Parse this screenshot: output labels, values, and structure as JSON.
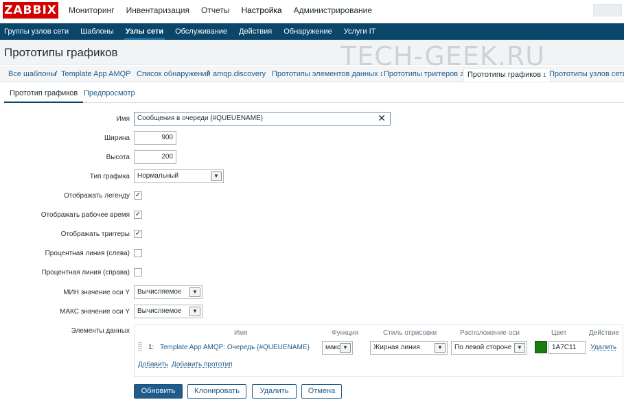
{
  "logo": "ZABBIX",
  "main_menu": [
    "Мониторинг",
    "Инвентаризация",
    "Отчеты",
    "Настройка",
    "Администрирование"
  ],
  "sub_menu": [
    "Группы узлов сети",
    "Шаблоны",
    "Узлы сети",
    "Обслуживание",
    "Действия",
    "Обнаружение",
    "Услуги IT"
  ],
  "page_title": "Прототипы графиков",
  "watermark": "TECH-GEEK.RU",
  "breadcrumbs": {
    "all_templates": "Все шаблоны",
    "template": "Template App AMQP",
    "discovery_list": "Список обнаружений",
    "discovery": "amqp.discovery",
    "item_prototypes": "Прототипы элементов данных",
    "item_prototypes_count": "1",
    "trigger_prototypes": "Прототипы триггеров",
    "trigger_prototypes_count": "2",
    "graph_prototypes": "Прототипы графиков",
    "graph_prototypes_count": "1",
    "host_prototypes": "Прототипы узлов сети"
  },
  "tabs": [
    "Прототип графиков",
    "Предпросмотр"
  ],
  "form": {
    "name_label": "Имя",
    "name_value": "Сообщения в очереди {#QUEUENAME}",
    "width_label": "Ширина",
    "width_value": "900",
    "height_label": "Высота",
    "height_value": "200",
    "graph_type_label": "Тип графика",
    "graph_type_value": "Нормальный",
    "show_legend_label": "Отображать легенду",
    "show_legend": true,
    "show_worktime_label": "Отображать рабочее время",
    "show_worktime": true,
    "show_triggers_label": "Отображать триггеры",
    "show_triggers": true,
    "percent_left_label": "Процентная линия (слева)",
    "percent_left": false,
    "percent_right_label": "Процентная линия (справа)",
    "percent_right": false,
    "ymin_label": "МИН значение оси Y",
    "ymin_value": "Вычисляемое",
    "ymax_label": "МАКС значение оси Y",
    "ymax_value": "Вычисляемое",
    "items_label": "Элементы данных"
  },
  "items_table": {
    "headers": {
      "name": "Имя",
      "function": "Функция",
      "draw_style": "Стиль отрисовки",
      "axis_side": "Расположение оси",
      "color": "Цвет",
      "action": "Действие"
    },
    "rows": [
      {
        "num": "1:",
        "name": "Template App AMQP: Очередь {#QUEUENAME}",
        "function": "макс",
        "draw_style": "Жирная линия",
        "axis_side": "По левой стороне",
        "color_hex": "#1A7C11",
        "color": "1A7C11",
        "remove": "Удалить"
      }
    ],
    "add": "Добавить",
    "add_prototype": "Добавить прототип"
  },
  "buttons": {
    "update": "Обновить",
    "clone": "Клонировать",
    "delete": "Удалить",
    "cancel": "Отмена"
  }
}
